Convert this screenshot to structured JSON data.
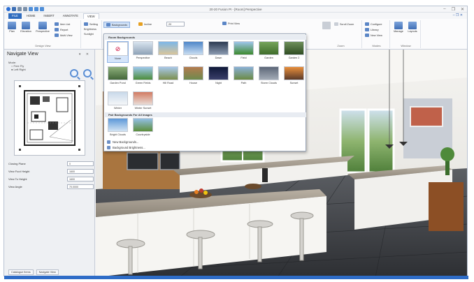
{
  "window": {
    "title": "20-20 Fusion PI - [Room] Perspective",
    "controls": [
      "–",
      "❐",
      "✕"
    ]
  },
  "ribbon_tabs": {
    "file": "FILE",
    "home": "HOME",
    "insert": "INSERT",
    "annotate": "ANNOTATE",
    "view": "VIEW",
    "right": "– ❐ ✕"
  },
  "ribbon": {
    "design_view": {
      "plan": "Plan",
      "elevation": "Elevation",
      "perspective": "Perspective",
      "item_list": "Item List",
      "report": "Report",
      "multi_view": "Multi-View",
      "label": "Design View"
    },
    "settings": {
      "setting": "Setting",
      "brightness": "Brightness",
      "sunlight": "Sunlight"
    },
    "backgrounds": {
      "label": "Backgrounds",
      "incline": "Incline",
      "incline_value": "20",
      "print_view": "Print View"
    },
    "zoom": {
      "scroll_zoom": "Scroll Zoom",
      "zoom_label": "Zoom",
      "group": "Zoom"
    },
    "modes": {
      "configure": "Configure",
      "library": "Library",
      "new_view": "New View",
      "group": "Modes"
    },
    "window": {
      "manage": "Manage",
      "layouts": "Layouts",
      "group": "Window"
    }
  },
  "navigate": {
    "title": "Navigate View",
    "controls": "▾ ✕",
    "mode_label": "Mode:",
    "mode_option1": "Free Fly",
    "mode_option2": "Left Right",
    "properties": [
      {
        "label": "Closing Plane",
        "value": "0"
      },
      {
        "label": "View Foot Height",
        "value": "1600"
      },
      {
        "label": "View To Height",
        "value": "1600"
      },
      {
        "label": "View Angle",
        "value": "70.0000"
      }
    ],
    "bottom_tabs": [
      "Catalogue Items",
      "Navigate View"
    ]
  },
  "backgrounds_menu": {
    "section1": "Room Backgrounds",
    "section2": "Pair Backgrounds For All Images",
    "items": [
      {
        "label": "None",
        "colors": [
          "#ffffff",
          "#ffffff"
        ]
      },
      {
        "label": "Perspective",
        "colors": [
          "#d9e4ef",
          "#8fa3b7"
        ]
      },
      {
        "label": "Beach",
        "colors": [
          "#7db7e8",
          "#d9c59a"
        ]
      },
      {
        "label": "Clouds",
        "colors": [
          "#4f87c9",
          "#c8dcf0"
        ]
      },
      {
        "label": "Dawn",
        "colors": [
          "#2d3b52",
          "#8b9ab0"
        ]
      },
      {
        "label": "Field",
        "colors": [
          "#9ec5ea",
          "#3d8a2e"
        ]
      },
      {
        "label": "Garden",
        "colors": [
          "#76a35b",
          "#3f6d2b"
        ]
      },
      {
        "label": "Garden 2",
        "colors": [
          "#6e8f5a",
          "#2f4d22"
        ]
      },
      {
        "label": "Garden Pond",
        "colors": [
          "#8eb07c",
          "#44673a"
        ]
      },
      {
        "label": "Green Fields",
        "colors": [
          "#9fc8ec",
          "#4c8d3a"
        ]
      },
      {
        "label": "Hill Road",
        "colors": [
          "#a8c8ea",
          "#7b8f4d"
        ]
      },
      {
        "label": "House",
        "colors": [
          "#b47b4f",
          "#6d8a4e"
        ]
      },
      {
        "label": "Night",
        "colors": [
          "#0f1838",
          "#3a3f6a"
        ]
      },
      {
        "label": "Path",
        "colors": [
          "#8ab0d6",
          "#6b8a43"
        ]
      },
      {
        "label": "Storm Clouds",
        "colors": [
          "#5c6778",
          "#a3abb6"
        ]
      },
      {
        "label": "Sunset",
        "colors": [
          "#e98f3c",
          "#5a3a2a"
        ]
      },
      {
        "label": "Winter",
        "colors": [
          "#c9d9ea",
          "#f4f6f8"
        ]
      },
      {
        "label": "Winter Sunset",
        "colors": [
          "#d27b62",
          "#e9dcd6"
        ]
      }
    ],
    "pair_items": [
      {
        "label": "Bright Clouds",
        "colors": [
          "#5d98d8",
          "#d2e3f3"
        ]
      },
      {
        "label": "Countryside",
        "colors": [
          "#92bfe5",
          "#5d8e3c"
        ]
      }
    ],
    "menu": [
      "New Backgrounds...",
      "Background Brightness..."
    ]
  }
}
